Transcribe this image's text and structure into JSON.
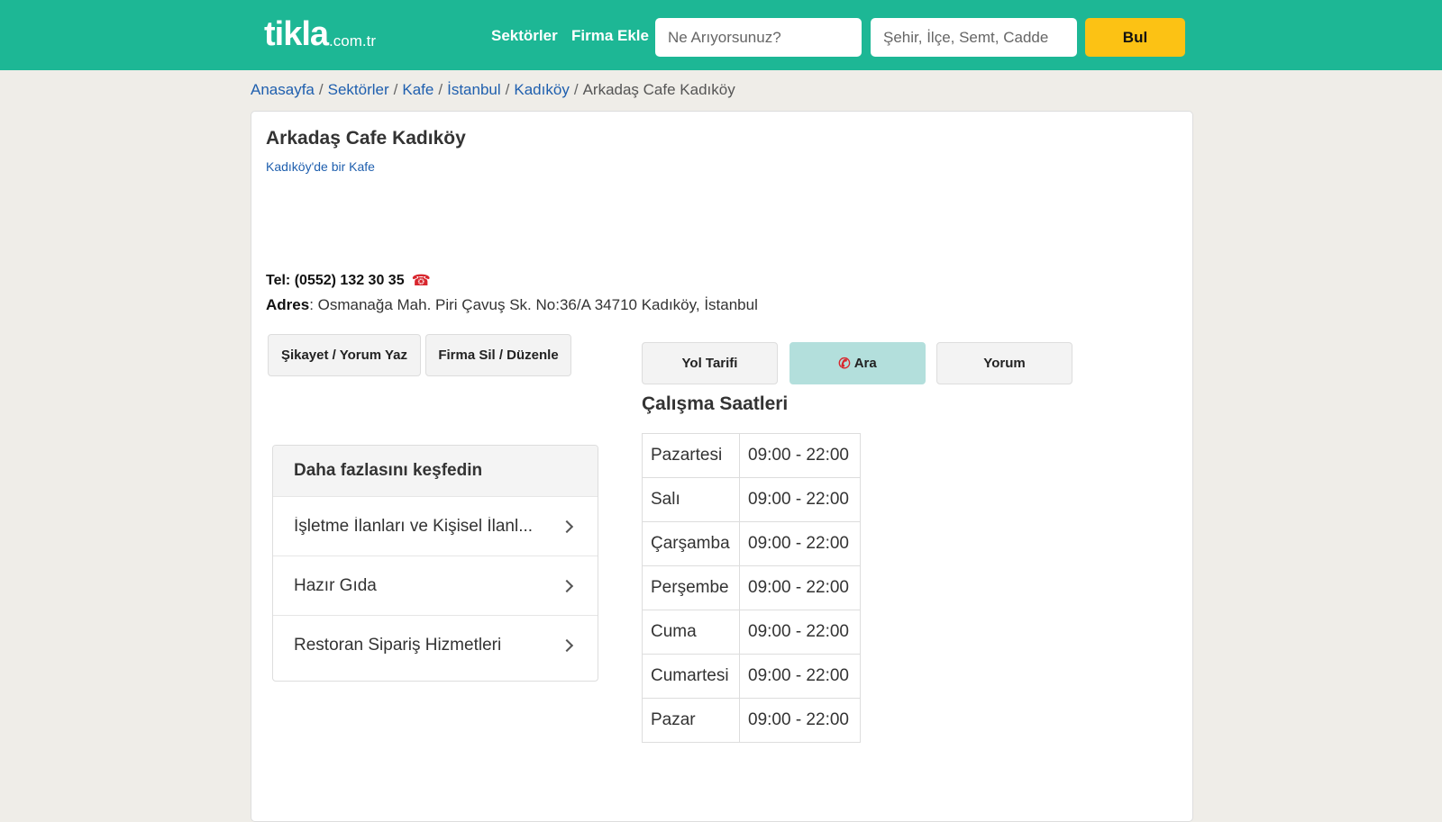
{
  "header": {
    "logo_main": "tikla",
    "logo_tld": ".com.tr",
    "nav": [
      "Sektörler",
      "Firma Ekle"
    ],
    "search_placeholder": "Ne Arıyorsunuz?",
    "location_placeholder": "Şehir, İlçe, Semt, Cadde",
    "search_button": "Bul",
    "colors": {
      "brand": "#1db795",
      "button": "#fcc214"
    }
  },
  "breadcrumb": {
    "links": [
      "Anasayfa",
      "Sektörler",
      "Kafe",
      "İstanbul",
      "Kadıköy"
    ],
    "current": "Arkadaş Cafe Kadıköy",
    "separator": "/"
  },
  "business": {
    "name": "Arkadaş Cafe Kadıköy",
    "subtitle": "Kadıköy'de bir Kafe",
    "phone_label": "Tel:",
    "phone": "(0552) 132 30 35",
    "phone_icon": "telephone-icon",
    "address_label": "Adres",
    "address": ": Osmanağa Mah. Piri Çavuş Sk. No:36/A 34710 Kadıköy, İstanbul"
  },
  "actions": {
    "complaint": "Şikayet / Yorum Yaz",
    "edit": "Firma Sil / Düzenle"
  },
  "tabs": {
    "directions": "Yol Tarifi",
    "call": "Ara",
    "call_icon": "phone-handset-icon",
    "review": "Yorum",
    "active": "call",
    "active_color": "#b3dfdc"
  },
  "hours": {
    "title": "Çalışma Saatleri",
    "rows": [
      {
        "day": "Pazartesi",
        "time": "09:00 - 22:00"
      },
      {
        "day": "Salı",
        "time": "09:00 - 22:00"
      },
      {
        "day": "Çarşamba",
        "time": "09:00 - 22:00"
      },
      {
        "day": "Perşembe",
        "time": "09:00 - 22:00"
      },
      {
        "day": "Cuma",
        "time": "09:00 - 22:00"
      },
      {
        "day": "Cumartesi",
        "time": "09:00 - 22:00"
      },
      {
        "day": "Pazar",
        "time": "09:00 - 22:00"
      }
    ]
  },
  "discover": {
    "title": "Daha fazlasını keşfedin",
    "items": [
      "İşletme İlanları ve Kişisel İlanl...",
      "Hazır Gıda",
      "Restoran Sipariş Hizmetleri"
    ]
  }
}
